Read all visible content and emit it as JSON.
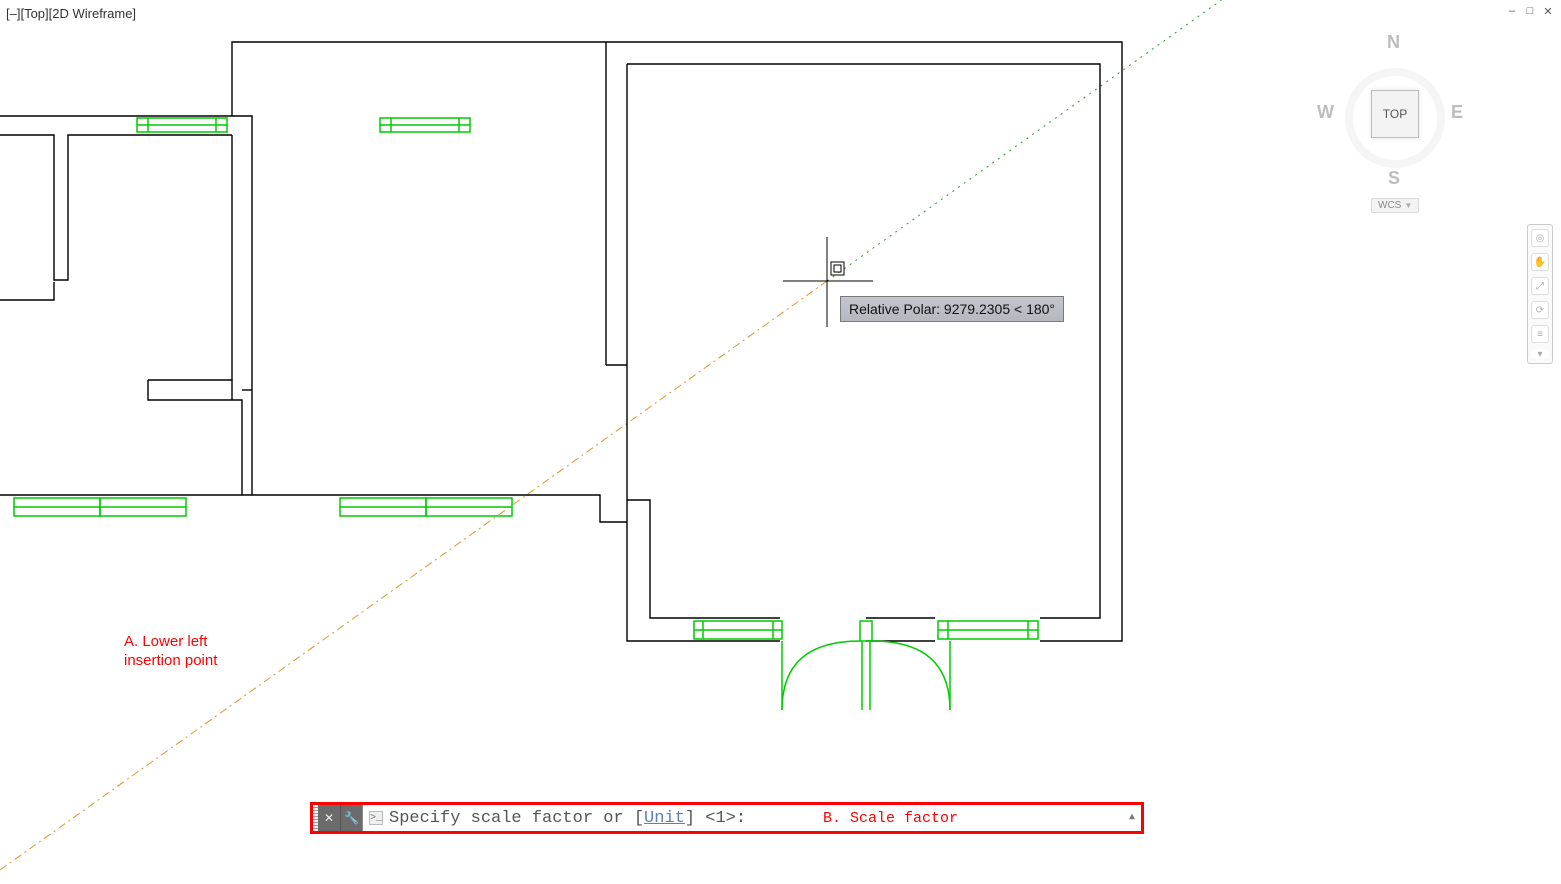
{
  "viewport": {
    "label": "[–][Top][2D Wireframe]"
  },
  "window_controls": {
    "minimize": "–",
    "maximize": "□",
    "close": "✕"
  },
  "tooltip": {
    "text": "Relative Polar: 9279.2305 < 180°"
  },
  "annotations": {
    "a_line1": "A. Lower left",
    "a_line2": "insertion point",
    "b": "B. Scale factor"
  },
  "viewcube": {
    "n": "N",
    "s": "S",
    "e": "E",
    "w": "W",
    "top": "TOP",
    "wcs": "WCS"
  },
  "navbar_icons": [
    "steering-wheel-icon",
    "pan-icon",
    "zoom-extents-icon",
    "orbit-icon",
    "show-motion-icon"
  ],
  "command": {
    "pre": "Specify scale factor or [",
    "option": "Unit",
    "post": "] <1>:",
    "icon_prompt": ">_"
  }
}
